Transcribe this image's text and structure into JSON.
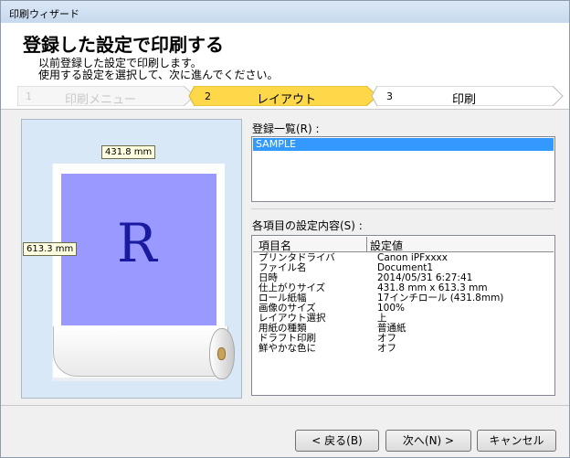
{
  "window": {
    "title": "印刷ウィザード"
  },
  "header": {
    "heading": "登録した設定で印刷する",
    "desc_line1": "以前登録した設定で印刷します。",
    "desc_line2": "使用する設定を選択して、次に進んでください。"
  },
  "steps": [
    {
      "num": "1",
      "label": "印刷メニュー",
      "state": "done"
    },
    {
      "num": "2",
      "label": "レイアウト",
      "state": "current"
    },
    {
      "num": "3",
      "label": "印刷",
      "state": "upcoming"
    }
  ],
  "preview": {
    "width_label": "431.8 mm",
    "height_label": "613.3 mm",
    "letter": "R",
    "print_color": "#9999ff"
  },
  "saved_list": {
    "label": "登録一覧(R) :",
    "items": [
      "SAMPLE"
    ],
    "selected": "SAMPLE"
  },
  "details": {
    "label": "各項目の設定内容(S) :",
    "col_item": "項目名",
    "col_value": "設定値",
    "rows": [
      {
        "k": "プリンタドライバ",
        "v": "Canon iPFxxxx"
      },
      {
        "k": "ファイル名",
        "v": "Document1"
      },
      {
        "k": "日時",
        "v": "2014/05/31 6:27:41"
      },
      {
        "k": "仕上がりサイズ",
        "v": "431.8 mm x 613.3 mm"
      },
      {
        "k": "ロール紙幅",
        "v": "17インチロール (431.8mm)"
      },
      {
        "k": "画像のサイズ",
        "v": "100%"
      },
      {
        "k": "レイアウト選択",
        "v": "上"
      },
      {
        "k": "用紙の種類",
        "v": "普通紙"
      },
      {
        "k": "ドラフト印刷",
        "v": "オフ"
      },
      {
        "k": "鮮やかな色に",
        "v": "オフ"
      }
    ]
  },
  "footer": {
    "back": "< 戻る(B)",
    "next": "次へ(N) >",
    "cancel": "キャンセル"
  },
  "colors": {
    "accent_step": "#ffd84a",
    "selection": "#3399ff",
    "preview_bg": "#d9e8f6"
  }
}
